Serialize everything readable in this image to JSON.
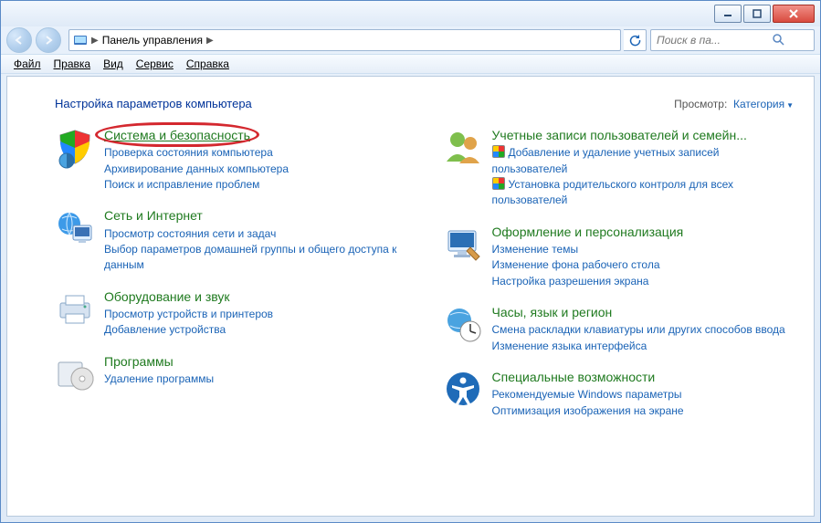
{
  "window": {
    "breadcrumb_root": "Панель управления"
  },
  "search": {
    "placeholder": "Поиск в па..."
  },
  "menu": {
    "file": "Файл",
    "edit": "Правка",
    "view": "Вид",
    "tools": "Сервис",
    "help": "Справка"
  },
  "header": {
    "title": "Настройка параметров компьютера",
    "view_label": "Просмотр:",
    "view_value": "Категория"
  },
  "cats": {
    "system": {
      "title": "Система и безопасность",
      "t1": "Проверка состояния компьютера",
      "t2": "Архивирование данных компьютера",
      "t3": "Поиск и исправление проблем"
    },
    "network": {
      "title": "Сеть и Интернет",
      "t1": "Просмотр состояния сети и задач",
      "t2": "Выбор параметров домашней группы и общего доступа к данным"
    },
    "hardware": {
      "title": "Оборудование и звук",
      "t1": "Просмотр устройств и принтеров",
      "t2": "Добавление устройства"
    },
    "programs": {
      "title": "Программы",
      "t1": "Удаление программы"
    },
    "users": {
      "title": "Учетные записи пользователей и семейн...",
      "t1": "Добавление и удаление учетных записей пользователей",
      "t2": "Установка родительского контроля для всех пользователей"
    },
    "appearance": {
      "title": "Оформление и персонализация",
      "t1": "Изменение темы",
      "t2": "Изменение фона рабочего стола",
      "t3": "Настройка разрешения экрана"
    },
    "clock": {
      "title": "Часы, язык и регион",
      "t1": "Смена раскладки клавиатуры или других способов ввода",
      "t2": "Изменение языка интерфейса"
    },
    "ease": {
      "title": "Специальные возможности",
      "t1": "Рекомендуемые Windows параметры",
      "t2": "Оптимизация изображения на экране"
    }
  }
}
